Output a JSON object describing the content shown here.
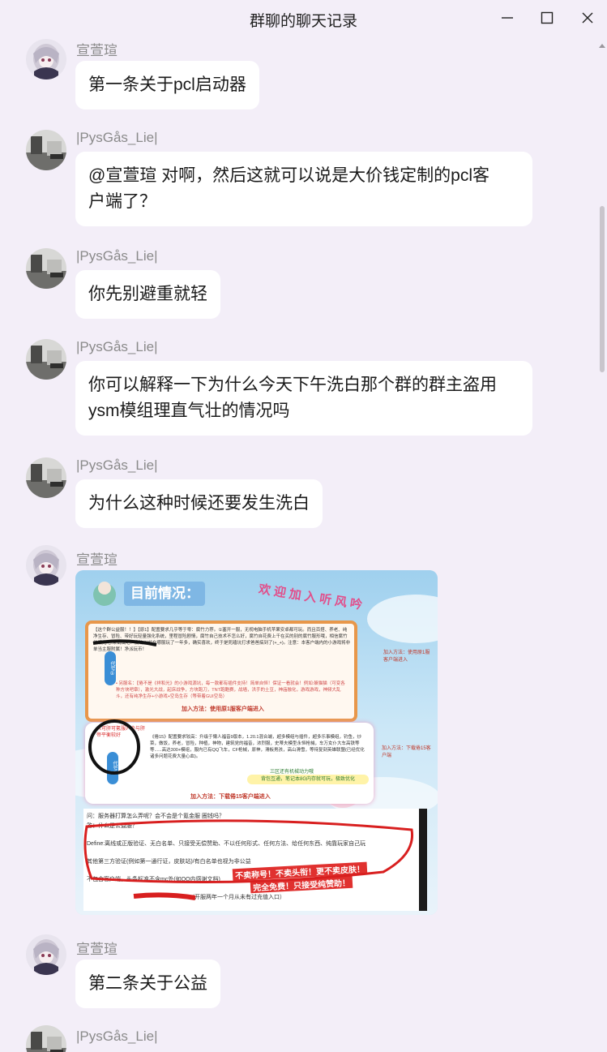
{
  "window": {
    "title": "群聊的聊天记录",
    "minimize_icon": "minimize-icon",
    "maximize_icon": "maximize-icon",
    "close_icon": "close-icon"
  },
  "messages": [
    {
      "sender": "宣萱瑄",
      "avatar": "anime-avatar",
      "text_lines": [
        "第一条关于pcl启动器"
      ]
    },
    {
      "sender": "|PysGås_Lie|",
      "avatar": "room-avatar",
      "text_lines": [
        "@宣萱瑄 对啊，然后这就可以说是大价钱定制的pcl客",
        "户端了？"
      ]
    },
    {
      "sender": "|PysGås_Lie|",
      "avatar": "room-avatar",
      "text_lines": [
        "你先别避重就轻"
      ]
    },
    {
      "sender": "|PysGås_Lie|",
      "avatar": "room-avatar",
      "text_lines": [
        "你可以解释一下为什么今天下午洗白那个群的群主盗用",
        "ysm模组理直气壮的情况吗"
      ]
    },
    {
      "sender": "|PysGås_Lie|",
      "avatar": "room-avatar",
      "text_lines": [
        "为什么这种时候还要发生洗白"
      ]
    },
    {
      "sender": "宣萱瑄",
      "avatar": "anime-avatar",
      "image": true
    },
    {
      "sender": "宣萱瑄",
      "avatar": "anime-avatar",
      "text_lines": [
        "第二条关于公益"
      ]
    },
    {
      "sender": "|PysGås_Lie|",
      "avatar": "room-avatar",
      "text_lines": []
    }
  ],
  "poster": {
    "header": "目前情况：",
    "welcome": "欢迎加入听风吟",
    "card1_text": "【这个群公益服！！】【原1】配置要求几乎等于零：腐竹力荐。①塞开一服，无视电脑手机苹果安卓都可玩。而且百搭、养老、纯净生存、冒险、带好玩轻量强化系统，里程冒险剧情，腐竹自己技术不怎么好，腐竹自花费上千在买的别的腐竹服形哦，相信腐竹的眼光吧!来试试吧！腐竹以前在哪服玩了一年多，确实喜欢，终于是死磕坑打求爸爸搞到了(+_+)。注意：本客户端内的小游戏将非单当主服附属！净派玩币！",
    "card1_note": "• 另服名：【倦不是《祥和光》的小游戏源坑，每一款都有插件支持！简单自恒！保证一看就会！例如:躲猫猫（可变各种方块吧章），激光大战，起床战争，方块跑刀，TNT跑酷赛，战墙，洪手的土豆，神庙融化，游戏游戏，神频大乱斗，还有纯净生存+小游戏+空岛生存（等带着GUI空岛）",
    "card1_join": "加入方法：使用原1服客户端进入",
    "card1_side": "加入方法：使用原1服客户端进入",
    "card1_tag": "代号①",
    "card2_badge": "《可肝可氪服》金与肝帝平衡较好",
    "card2_text": "《倦15》配置要求较高：升级于懒人福音9版本，1.20.1混合端，超多模组与插件，超多乐事模组，钓鱼，炒菜，做饭，养老，冒险，种植，神物，建筑党的福音，浓烈服，史蒂夫模型永恒枪械，车万女仆大车高铁等等......高达300+模组，服内已有QQ飞车，CF枪械，原神，滑板男孩，高山滑雪，等待复刻英雄联盟(已经优化诸多问题花费大量心血)。",
    "card2_join": "加入方法：下载倦15客户端进入",
    "card2_side": "加入方法：下载倦15客户端",
    "card2_tag": "代号②",
    "card2_bubble": "背包互通，笔记本8G内存就可玩，极致优化",
    "card2_bubble2": "三区还有机械动力哦",
    "doc_q1": "问：服务器打算怎么弄呢？会不会是个氪金服 圈钱吗？",
    "doc_q2": "答：什么是公益服？",
    "doc_def": "Define:离线或正版验证、无白名单、只接受无偿赞助、不以任何形式、任何方法、给任何东西、纯靠玩家自己玩",
    "doc_line3": "其他第三方验证(例如第一通行证，皮肤站)/有白名单也视为非公益",
    "doc_line4": "不包含客户端，头条标准不含mc外(如QQ内感谢文档)",
    "doc_line5": "（开服两年一个月从未有过充值入口）",
    "doc_stamp1": "不卖称号！不卖头衔！更不卖皮肤！",
    "doc_stamp2": "完全免费！只接受纯赞助！"
  }
}
